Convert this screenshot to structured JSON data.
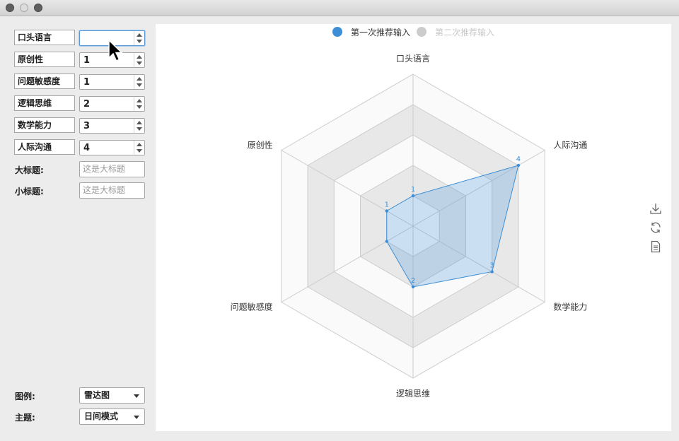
{
  "window": {
    "title": ""
  },
  "form": {
    "rows": [
      {
        "label": "口头语言",
        "value": ""
      },
      {
        "label": "原创性",
        "value": "1"
      },
      {
        "label": "问题敏感度",
        "value": "1"
      },
      {
        "label": "逻辑思维",
        "value": "2"
      },
      {
        "label": "数学能力",
        "value": "3"
      },
      {
        "label": "人际沟通",
        "value": "4"
      }
    ],
    "title_label": "大标题:",
    "title_placeholder": "这是大标题",
    "subtitle_label": "小标题:",
    "subtitle_placeholder": "这是大标题",
    "legend_label": "图例:",
    "legend_value": "雷达图",
    "theme_label": "主题:",
    "theme_value": "日间模式"
  },
  "toolbox": {
    "icons": [
      "download-icon",
      "refresh-icon",
      "data-view-icon"
    ]
  },
  "colors": {
    "series1": "#3c8fd6",
    "series2": "#cccccc",
    "split_dark": "#e8e8e8",
    "split_light": "#fafafa"
  },
  "chart_data": {
    "type": "radar",
    "indicators": [
      "口头语言",
      "人际沟通",
      "数学能力",
      "逻辑思维",
      "问题敏感度",
      "原创性"
    ],
    "max": 5,
    "series": [
      {
        "name": "第一次推荐输入",
        "values": [
          1,
          4,
          3,
          2,
          1,
          1
        ],
        "labels": [
          "1",
          "4",
          "3",
          "2",
          "",
          "1"
        ],
        "active": true
      },
      {
        "name": "第二次推荐输入",
        "values": [],
        "active": false
      }
    ],
    "legend_position": "top-center"
  }
}
